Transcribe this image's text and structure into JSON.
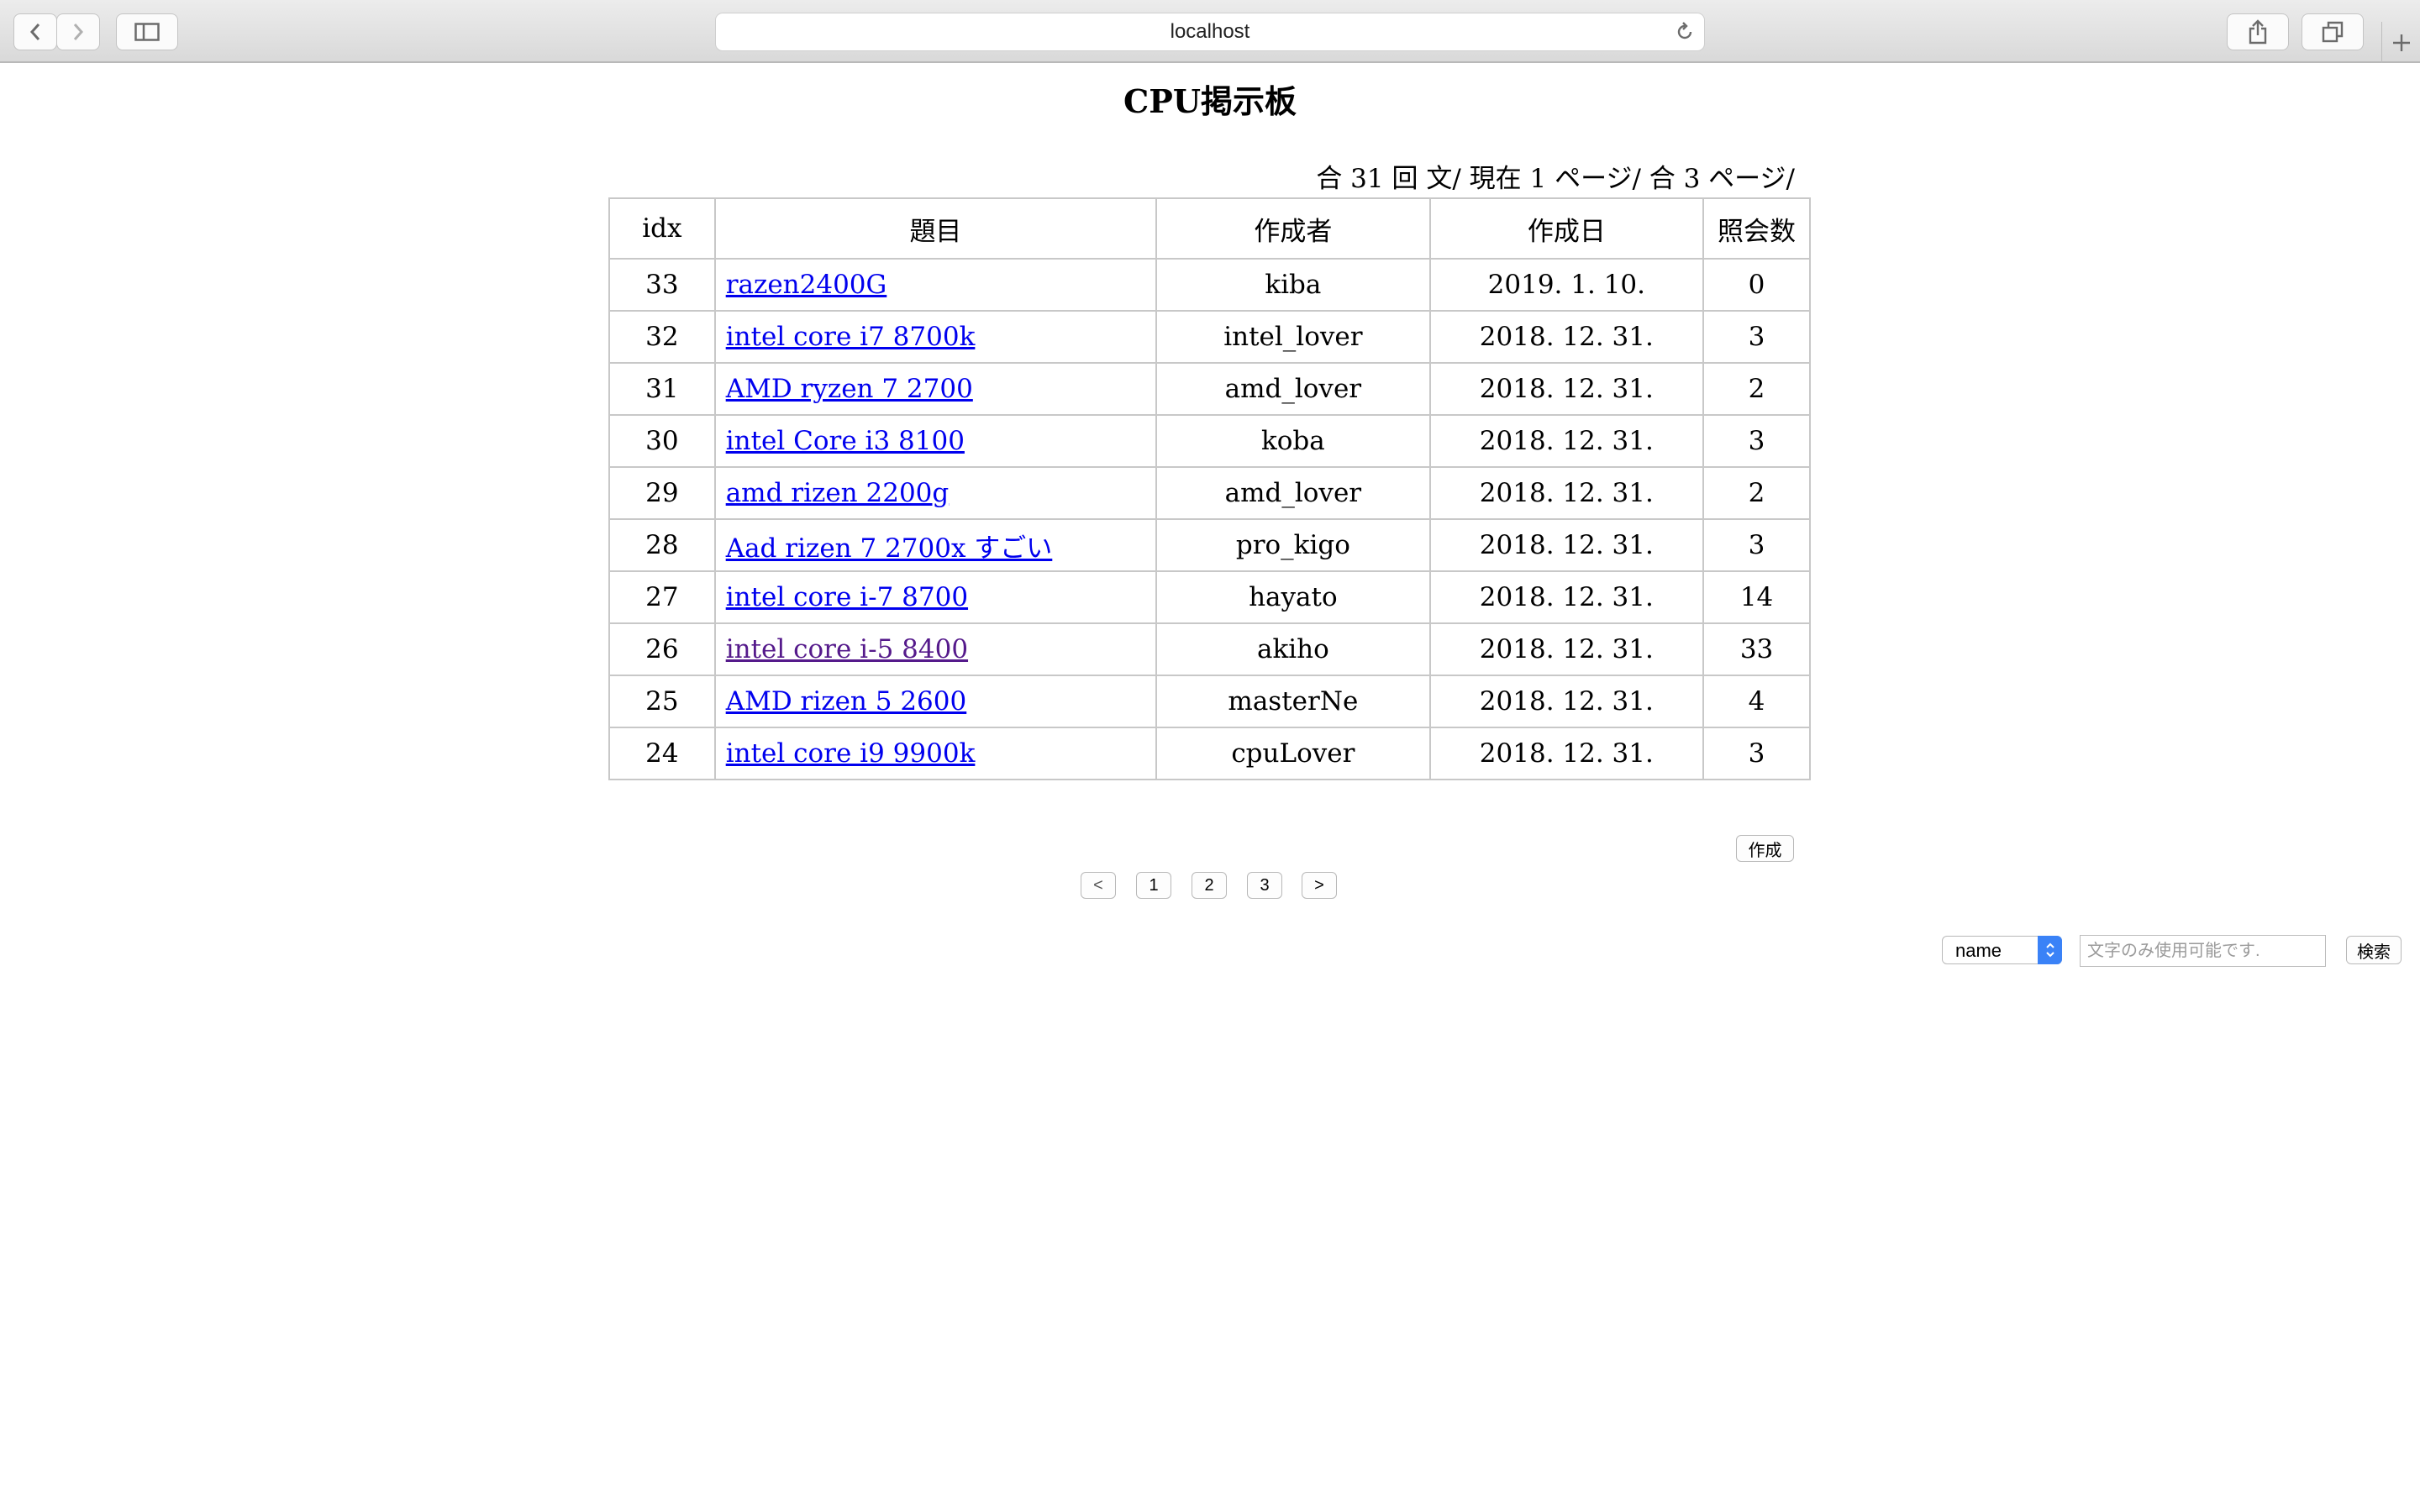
{
  "browser": {
    "url": "localhost",
    "icons": {
      "back": "chevron-left-icon",
      "forward": "chevron-right-icon",
      "sidebar": "sidebar-icon",
      "reload": "reload-icon",
      "share": "share-icon",
      "tabs": "tabs-icon",
      "new_tab": "plus-icon"
    }
  },
  "page": {
    "title": "CPU掲示板",
    "summary": "合 31 回 文/ 現在 1 ページ/ 合 3 ページ/"
  },
  "table": {
    "headers": [
      "idx",
      "題目",
      "作成者",
      "作成日",
      "照会数"
    ],
    "rows": [
      {
        "idx": "33",
        "title": "razen2400G",
        "author": "kiba",
        "date": "2019. 1. 10.",
        "views": "0"
      },
      {
        "idx": "32",
        "title": "intel core i7 8700k",
        "author": "intel_lover",
        "date": "2018. 12. 31.",
        "views": "3"
      },
      {
        "idx": "31",
        "title": "AMD ryzen 7 2700",
        "author": "amd_lover",
        "date": "2018. 12. 31.",
        "views": "2"
      },
      {
        "idx": "30",
        "title": "intel Core i3 8100",
        "author": "koba",
        "date": "2018. 12. 31.",
        "views": "3"
      },
      {
        "idx": "29",
        "title": "amd rizen 2200g",
        "author": "amd_lover",
        "date": "2018. 12. 31.",
        "views": "2"
      },
      {
        "idx": "28",
        "title": "Aad rizen 7 2700x すごい",
        "author": "pro_kigo",
        "date": "2018. 12. 31.",
        "views": "3"
      },
      {
        "idx": "27",
        "title": "intel core i-7 8700",
        "author": "hayato",
        "date": "2018. 12. 31.",
        "views": "14"
      },
      {
        "idx": "26",
        "title": "intel core i-5 8400",
        "author": "akiho",
        "date": "2018. 12. 31.",
        "views": "33"
      },
      {
        "idx": "25",
        "title": "AMD rizen 5 2600",
        "author": "masterNe",
        "date": "2018. 12. 31.",
        "views": "4"
      },
      {
        "idx": "24",
        "title": "intel core i9 9900k",
        "author": "cpuLover",
        "date": "2018. 12. 31.",
        "views": "3"
      }
    ]
  },
  "actions": {
    "create_label": "作成"
  },
  "pagination": {
    "prev": "<",
    "pages": [
      "1",
      "2",
      "3"
    ],
    "next": ">"
  },
  "search": {
    "field_value": "name",
    "placeholder": "文字のみ使用可能です.",
    "button_label": "検索"
  },
  "colors": {
    "link": "#0000ee",
    "visited_link": "#551a8b",
    "select_accent": "#3a82f7"
  }
}
